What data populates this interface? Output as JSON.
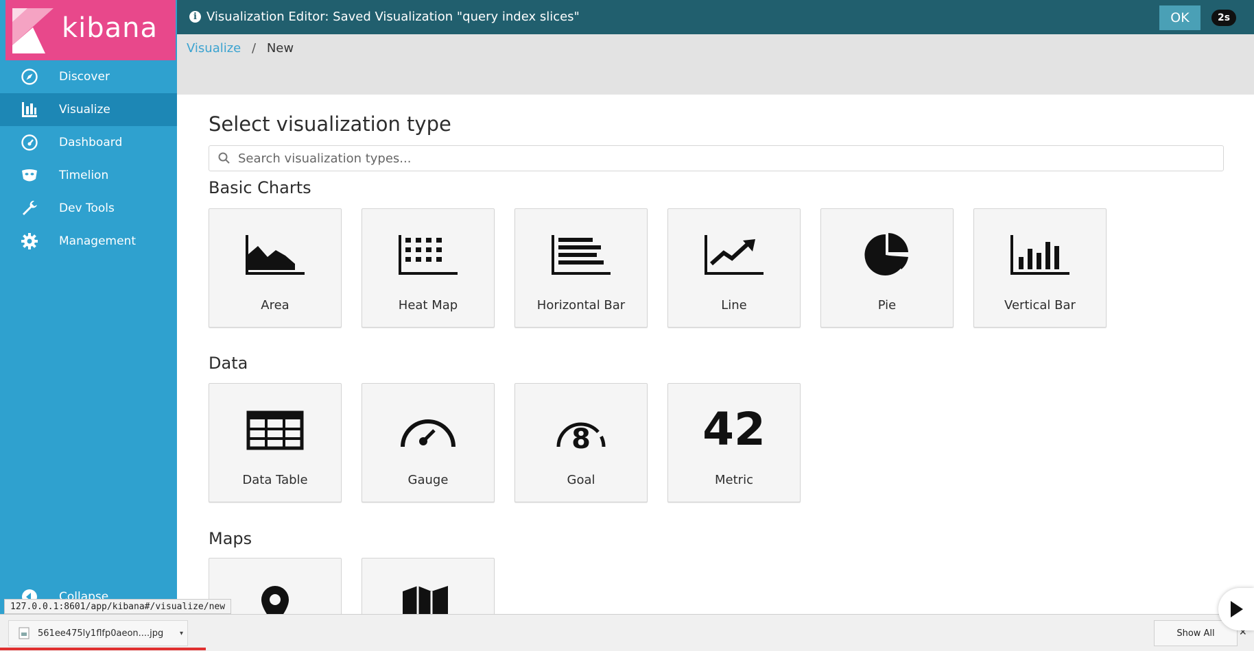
{
  "brand": {
    "name": "kibana",
    "color": "#e8488b"
  },
  "sidebar": {
    "items": [
      {
        "label": "Discover",
        "icon": "compass-icon"
      },
      {
        "label": "Visualize",
        "icon": "bar-chart-icon",
        "active": true
      },
      {
        "label": "Dashboard",
        "icon": "dashboard-gauge-icon"
      },
      {
        "label": "Timelion",
        "icon": "timelion-mask-icon"
      },
      {
        "label": "Dev Tools",
        "icon": "wrench-icon"
      },
      {
        "label": "Management",
        "icon": "gear-icon"
      }
    ],
    "collapse_label": "Collapse"
  },
  "topbar": {
    "message": "Visualization Editor: Saved Visualization \"query index slices\"",
    "ok_label": "OK",
    "timer": "2s"
  },
  "breadcrumb": {
    "link": "Visualize",
    "separator": "/",
    "current": "New"
  },
  "main": {
    "title": "Select visualization type",
    "search_placeholder": "Search visualization types...",
    "sections": [
      {
        "title": "Basic Charts",
        "tiles": [
          {
            "label": "Area",
            "icon": "area-chart-icon"
          },
          {
            "label": "Heat Map",
            "icon": "heat-map-icon"
          },
          {
            "label": "Horizontal Bar",
            "icon": "horizontal-bar-icon"
          },
          {
            "label": "Line",
            "icon": "line-chart-icon"
          },
          {
            "label": "Pie",
            "icon": "pie-chart-icon"
          },
          {
            "label": "Vertical Bar",
            "icon": "vertical-bar-icon"
          }
        ]
      },
      {
        "title": "Data",
        "tiles": [
          {
            "label": "Data Table",
            "icon": "data-table-icon"
          },
          {
            "label": "Gauge",
            "icon": "gauge-icon"
          },
          {
            "label": "Goal",
            "icon": "goal-icon"
          },
          {
            "label": "Metric",
            "icon": "metric-icon",
            "value": "42"
          }
        ]
      },
      {
        "title": "Maps",
        "tiles": [
          {
            "label": "",
            "icon": "map-pin-icon"
          },
          {
            "label": "",
            "icon": "region-map-icon"
          }
        ]
      }
    ]
  },
  "browser": {
    "status_url": "127.0.0.1:8601/app/kibana#/visualize/new",
    "download_filename": "561ee475ly1flfp0aeon....jpg",
    "show_all_label": "Show All"
  },
  "colors": {
    "sidebar": "#2fa1cf",
    "sidebar_active": "#1d87b5",
    "topbar": "#215f6e",
    "ok_button": "#4aa0b6",
    "link": "#3ba3d0"
  }
}
